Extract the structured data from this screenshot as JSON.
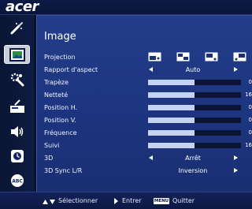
{
  "app": {
    "brand": "acer"
  },
  "sidebar": {
    "items": [
      {
        "icon": "color-wand-icon",
        "active": false
      },
      {
        "icon": "image-icon",
        "active": true
      },
      {
        "icon": "settings-wrench-icon",
        "active": false
      },
      {
        "icon": "management-icon",
        "active": false
      },
      {
        "icon": "speaker-icon",
        "active": false
      },
      {
        "icon": "timer-icon",
        "active": false
      },
      {
        "icon": "language-abc-icon",
        "active": false
      }
    ]
  },
  "panel": {
    "title": "Image",
    "rows": [
      {
        "label": "Projection",
        "type": "icons",
        "icons": [
          "projection-front-desk-icon",
          "projection-rear-desk-icon",
          "projection-front-ceiling-icon",
          "projection-rear-ceiling-icon"
        ]
      },
      {
        "label": "Rapport d'aspect",
        "type": "select",
        "value": "Auto"
      },
      {
        "label": "Trapèze",
        "type": "slider",
        "value": "0",
        "fraction": 0.5
      },
      {
        "label": "Netteté",
        "type": "slider",
        "value": "16",
        "fraction": 0.5
      },
      {
        "label": "Position H.",
        "type": "slider",
        "value": "0",
        "fraction": 0.5
      },
      {
        "label": "Position V.",
        "type": "slider",
        "value": "0",
        "fraction": 0.5
      },
      {
        "label": "Fréquence",
        "type": "slider",
        "value": "0",
        "fraction": 0.5
      },
      {
        "label": "Suivi",
        "type": "slider",
        "value": "16",
        "fraction": 0.5
      },
      {
        "label": "3D",
        "type": "select",
        "value": "Arrêt"
      },
      {
        "label": "3D Sync L/R",
        "type": "select",
        "value": "Inversion"
      }
    ]
  },
  "footer": {
    "select_label": "Sélectionner",
    "enter_label": "Entrer",
    "menu_badge": "MENU",
    "quit_label": "Quitter"
  },
  "colors": {
    "panel": "#1f3882",
    "background": "#0a1226",
    "slider_fill": "#c6d3ee",
    "slider_track": "#0b1430"
  }
}
